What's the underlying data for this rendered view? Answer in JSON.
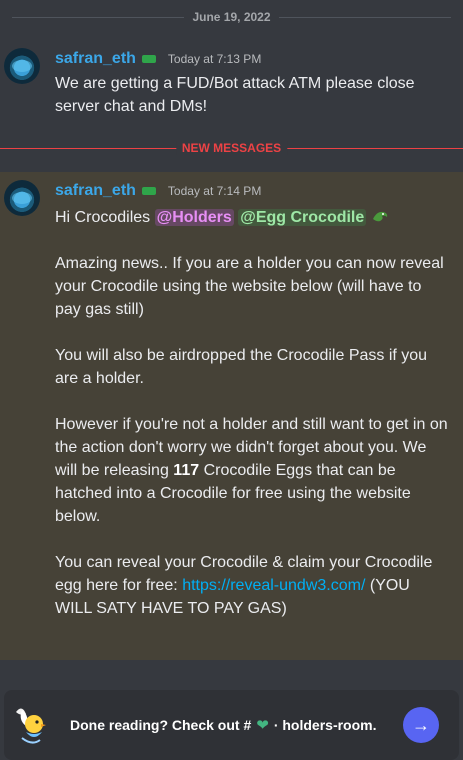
{
  "date_divider": "June 19, 2022",
  "new_messages_label": "NEW MESSAGES",
  "messages": [
    {
      "username": "safran_eth",
      "timestamp": "Today at 7:13 PM",
      "text": "We are getting a FUD/Bot attack ATM please close server chat and DMs!"
    },
    {
      "username": "safran_eth",
      "timestamp": "Today at 7:14 PM",
      "greeting": "Hi Crocodiles",
      "mention_holders": "@Holders",
      "mention_egg": "@Egg Crocodile",
      "p1": "Amazing news.. If you are a holder you can now reveal your Crocodile using the website below (will have to pay gas still)",
      "p2": "You will also be airdropped the Crocodile Pass if you are a holder.",
      "p3_before": "However if you're not a holder and still want to get in on the action don't worry we didn't forget about you. We will be releasing",
      "p3_number": "117",
      "p3_after": "Crocodile Eggs that can be hatched into a Crocodile for free using the website below.",
      "p4_before": "You can reveal your Crocodile & claim your Crocodile egg here for free:",
      "p4_link": "https://reveal-undw3.com/",
      "p4_after": "(YOU WILL SATY HAVE TO PAY GAS)"
    }
  ],
  "bottom_bar": {
    "prefix": "Done reading? Check out #",
    "channel": "· holders-room."
  },
  "colors": {
    "background": "#36393f",
    "highlight": "#464237",
    "username": "#3ba7e8",
    "new_messages": "#ed4245",
    "link": "#00aff4",
    "button": "#5865f2"
  },
  "icons": {
    "role": "role-icon",
    "crocodile_emoji": "crocodile-emoji-icon",
    "heart": "green-heart-icon",
    "arrow": "arrow-right-icon"
  }
}
